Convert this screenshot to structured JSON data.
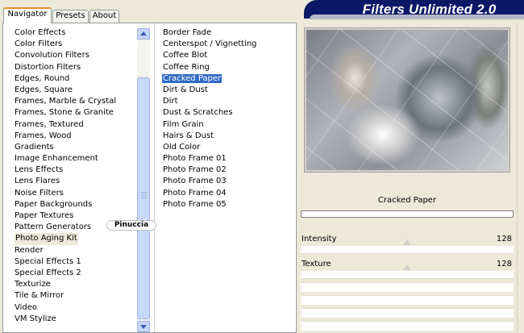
{
  "tabs": [
    {
      "label": "Navigator",
      "active": true
    },
    {
      "label": "Presets",
      "active": false
    },
    {
      "label": "About",
      "active": false
    }
  ],
  "app_title": "Filters Unlimited 2.0",
  "categories": [
    "Color Effects",
    "Color Filters",
    "Convolution Filters",
    "Distortion Filters",
    "Edges, Round",
    "Edges, Square",
    "Frames, Marble & Crystal",
    "Frames, Stone & Granite",
    "Frames, Textured",
    "Frames, Wood",
    "Gradients",
    "Image Enhancement",
    "Lens Effects",
    "Lens Flares",
    "Noise Filters",
    "Paper Backgrounds",
    "Paper Textures",
    "Pattern Generators",
    "Photo Aging Kit",
    "Render",
    "Special Effects 1",
    "Special Effects 2",
    "Texturize",
    "Tile & Mirror",
    "Video",
    "VM Stylize"
  ],
  "selected_category": "Photo Aging Kit",
  "filters": [
    "Border Fade",
    "Centerspot / Vignetting",
    "Coffee Blot",
    "Coffee Ring",
    "Cracked Paper",
    "Dirt & Dust",
    "Dirt",
    "Dust & Scratches",
    "Film Grain",
    "Hairs & Dust",
    "Old Color",
    "Photo Frame 01",
    "Photo Frame 02",
    "Photo Frame 03",
    "Photo Frame 04",
    "Photo Frame 05"
  ],
  "selected_filter": "Cracked Paper",
  "watermark": "Pinuccia",
  "preview": {
    "filter_name": "Cracked Paper"
  },
  "sliders": [
    {
      "label": "Intensity",
      "value": "128",
      "level": 0.5
    },
    {
      "label": "Texture",
      "value": "128",
      "level": 0.5
    }
  ],
  "colors": {
    "banner": "#0b1866",
    "selection": "#316ac5",
    "tab_accent": "#e68b2c"
  }
}
